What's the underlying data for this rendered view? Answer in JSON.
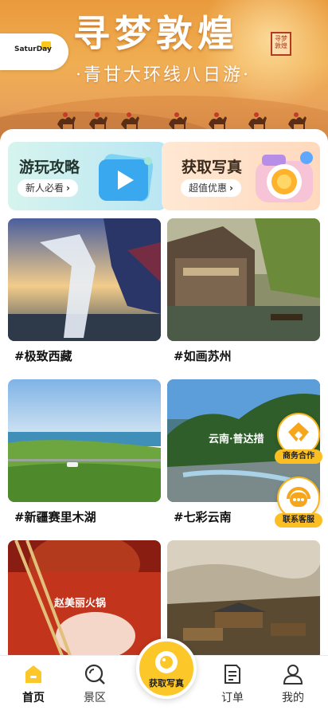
{
  "banner": {
    "title": "寻梦敦煌",
    "subtitle": "·青甘大环线八日游·",
    "seal_text": "寻梦敦煌",
    "logo_text": "SaturDay"
  },
  "promos": [
    {
      "title": "游玩攻略",
      "badge": "新人必看",
      "icon": "play-icon"
    },
    {
      "title": "获取写真",
      "badge": "超值优惠",
      "icon": "camera-icon"
    }
  ],
  "tiles": [
    {
      "caption": "#极致西藏"
    },
    {
      "caption": "#如画苏州"
    },
    {
      "caption": "#新疆赛里木湖"
    },
    {
      "caption": "#七彩云南"
    },
    {
      "caption": ""
    },
    {
      "caption": ""
    }
  ],
  "tile_texts": {
    "yunnan_overlay": "云南·普达措",
    "hotpot_overlay": "赵美丽火锅"
  },
  "floating": {
    "business": "商务合作",
    "service": "联系客服"
  },
  "nav": {
    "home": "首页",
    "scenic": "景区",
    "center": "获取写真",
    "orders": "订单",
    "mine": "我的"
  },
  "colors": {
    "accent": "#fcc728",
    "banner": "#eea34e"
  }
}
